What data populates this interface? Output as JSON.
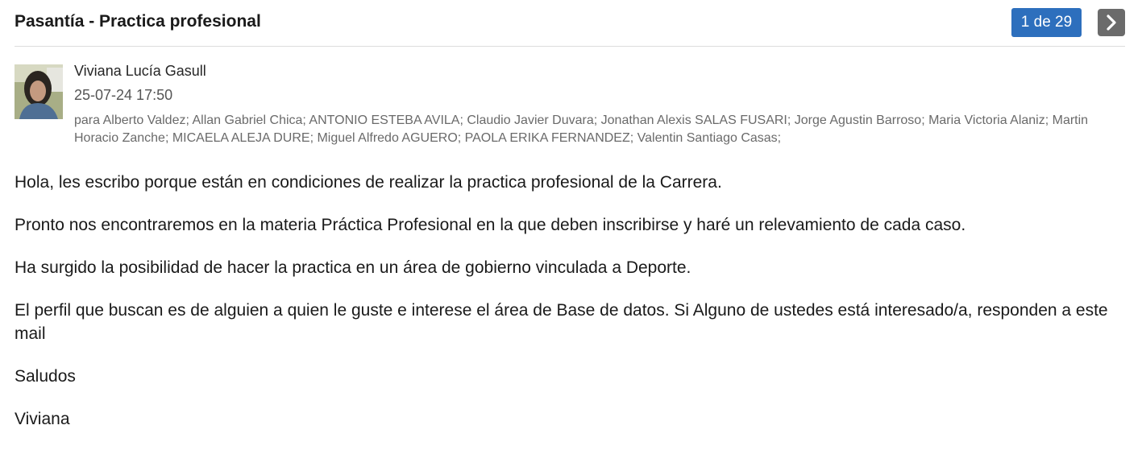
{
  "header": {
    "subject": "Pasantía - Practica profesional",
    "counter": "1 de 29",
    "next_icon": "chevron-right-icon"
  },
  "message": {
    "sender": "Viviana Lucía Gasull",
    "date": "25-07-24 17:50",
    "recipients": "para Alberto Valdez; Allan Gabriel Chica; ANTONIO ESTEBA AVILA; Claudio Javier Duvara; Jonathan Alexis SALAS FUSARI; Jorge Agustin Barroso; Maria Victoria Alaniz; Martin Horacio Zanche; MICAELA ALEJA DURE; Miguel Alfredo AGUERO; PAOLA ERIKA FERNANDEZ; Valentin Santiago Casas;",
    "paragraphs": [
      "Hola, les escribo porque están en condiciones de realizar la practica profesional de la Carrera.",
      "Pronto nos encontraremos en la materia Práctica Profesional en la que deben inscribirse y haré un relevamiento de cada caso.",
      "Ha surgido la posibilidad de hacer la practica en un área de gobierno vinculada a Deporte.",
      "El perfil que buscan es de alguien a quien le guste e interese el área de Base de datos. Si Alguno de ustedes está interesado/a, responden a este mail",
      "Saludos",
      "Viviana"
    ]
  },
  "colors": {
    "counter_bg": "#2d6fbd",
    "next_button_bg": "#6b6b6b"
  }
}
